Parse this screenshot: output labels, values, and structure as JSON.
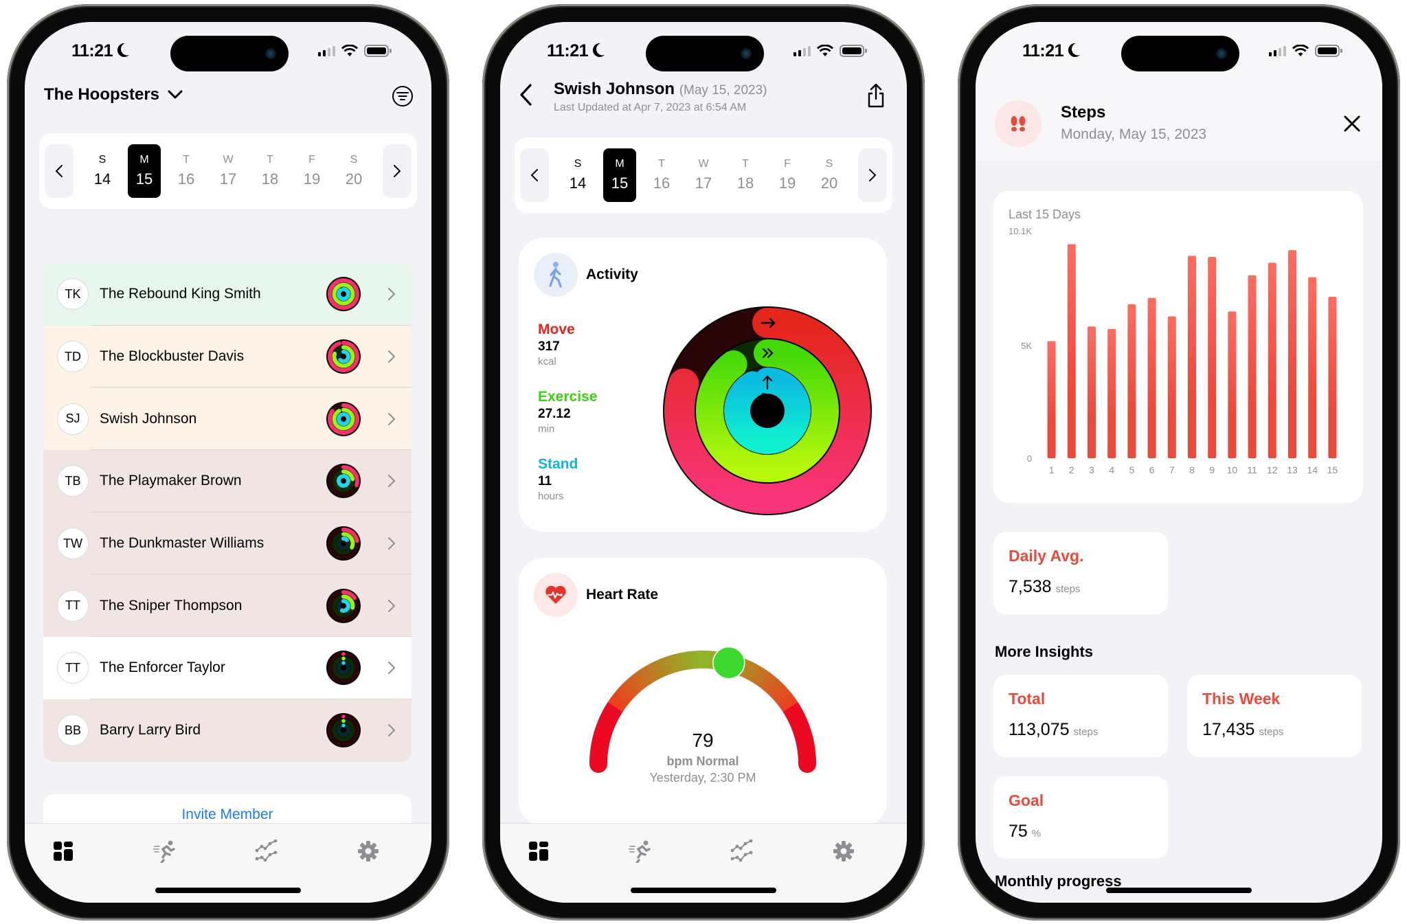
{
  "status_bar": {
    "time": "11:21",
    "focus_icon": "moon-icon",
    "signal_bars_active": 2,
    "signal_bars_total": 4
  },
  "week": {
    "days": [
      {
        "letter": "S",
        "num": "14",
        "state": "past"
      },
      {
        "letter": "M",
        "num": "15",
        "state": "selected"
      },
      {
        "letter": "T",
        "num": "16",
        "state": "future"
      },
      {
        "letter": "W",
        "num": "17",
        "state": "future"
      },
      {
        "letter": "T",
        "num": "18",
        "state": "future"
      },
      {
        "letter": "F",
        "num": "19",
        "state": "future"
      },
      {
        "letter": "S",
        "num": "20",
        "state": "future"
      }
    ]
  },
  "team_screen": {
    "team_name": "The Hoopsters",
    "members": [
      {
        "initials": "TK",
        "name": "The Rebound King Smith",
        "bg": "#e8f7ee",
        "move": 1.0,
        "exercise": 0.98,
        "stand": 0.9
      },
      {
        "initials": "TD",
        "name": "The Blockbuster Davis",
        "bg": "#fef3e7",
        "move": 0.95,
        "exercise": 0.8,
        "stand": 0.62
      },
      {
        "initials": "SJ",
        "name": "Swish Johnson",
        "bg": "#fef3e7",
        "move": 0.85,
        "exercise": 0.92,
        "stand": 0.92
      },
      {
        "initials": "TB",
        "name": "The Playmaker Brown",
        "bg": "#f1e5e3",
        "move": 0.3,
        "exercise": 0.22,
        "stand": 0.95
      },
      {
        "initials": "TW",
        "name": "The Dunkmaster Williams",
        "bg": "#f1e5e3",
        "move": 0.22,
        "exercise": 0.32,
        "stand": 0.12
      },
      {
        "initials": "TT",
        "name": "The Sniper Thompson",
        "bg": "#f1e5e3",
        "move": 0.15,
        "exercise": 0.28,
        "stand": 0.55
      },
      {
        "initials": "TT",
        "name": "The Enforcer Taylor",
        "bg": "#ffffff",
        "move": 0.0,
        "exercise": 0.0,
        "stand": 0.0
      },
      {
        "initials": "BB",
        "name": "Barry Larry Bird",
        "bg": "#f1e5e3",
        "move": 0.0,
        "exercise": 0.0,
        "stand": 0.0
      }
    ],
    "invite_label": "Invite Member"
  },
  "tabbar": {
    "tabs": [
      {
        "name": "dashboard",
        "icon": "grid-icon",
        "active": true
      },
      {
        "name": "activity",
        "icon": "running-icon",
        "active": false
      },
      {
        "name": "trends",
        "icon": "trend-chart-icon",
        "active": false
      },
      {
        "name": "settings",
        "icon": "gear-icon",
        "active": false
      }
    ]
  },
  "member_screen": {
    "name": "Swish Johnson",
    "date": "(May 15, 2023)",
    "last_updated": "Last Updated at Apr 7, 2023 at 6:54 AM",
    "activity": {
      "title": "Activity",
      "move": {
        "label": "Move",
        "value": "317",
        "unit": "kcal",
        "color": "#e8231c",
        "progress": 0.8
      },
      "exercise": {
        "label": "Exercise",
        "value": "27.12",
        "unit": "min",
        "color": "#3ccf12",
        "progress": 0.9
      },
      "stand": {
        "label": "Stand",
        "value": "11",
        "unit": "hours",
        "color": "#15b3dc",
        "progress": 0.92
      }
    },
    "heart_rate": {
      "title": "Heart Rate",
      "value": "79",
      "status": "bpm Normal",
      "time": "Yesterday, 2:30 PM",
      "gauge_position": 0.58
    }
  },
  "steps_screen": {
    "title": "Steps",
    "date": "Monday, May 15, 2023",
    "chart_caption": "Last 15 Days",
    "daily_avg": {
      "label": "Daily Avg.",
      "value": "7,538",
      "unit": "steps"
    },
    "more_insights_label": "More Insights",
    "total": {
      "label": "Total",
      "value": "113,075",
      "unit": "steps"
    },
    "this_week": {
      "label": "This Week",
      "value": "17,435",
      "unit": "steps"
    },
    "goal": {
      "label": "Goal",
      "value": "75",
      "unit": "%"
    },
    "monthly_progress_label": "Monthly progress",
    "accent": "#ea4a3c"
  },
  "chart_data": {
    "type": "bar",
    "title": "Last 15 Days",
    "xlabel": "",
    "ylabel": "",
    "categories": [
      "1",
      "2",
      "3",
      "4",
      "5",
      "6",
      "7",
      "8",
      "9",
      "10",
      "11",
      "12",
      "13",
      "14",
      "15"
    ],
    "values": [
      5200,
      9510,
      5850,
      5740,
      6840,
      7120,
      6300,
      8990,
      8940,
      6520,
      8120,
      8680,
      9240,
      8040,
      7170
    ],
    "yticks": [
      {
        "value": 0,
        "label": "0"
      },
      {
        "value": 5000,
        "label": "5K"
      },
      {
        "value": 10100,
        "label": "10.1K"
      }
    ],
    "ylim": [
      0,
      10100
    ],
    "grid": false,
    "color": "#ea4a3c"
  }
}
